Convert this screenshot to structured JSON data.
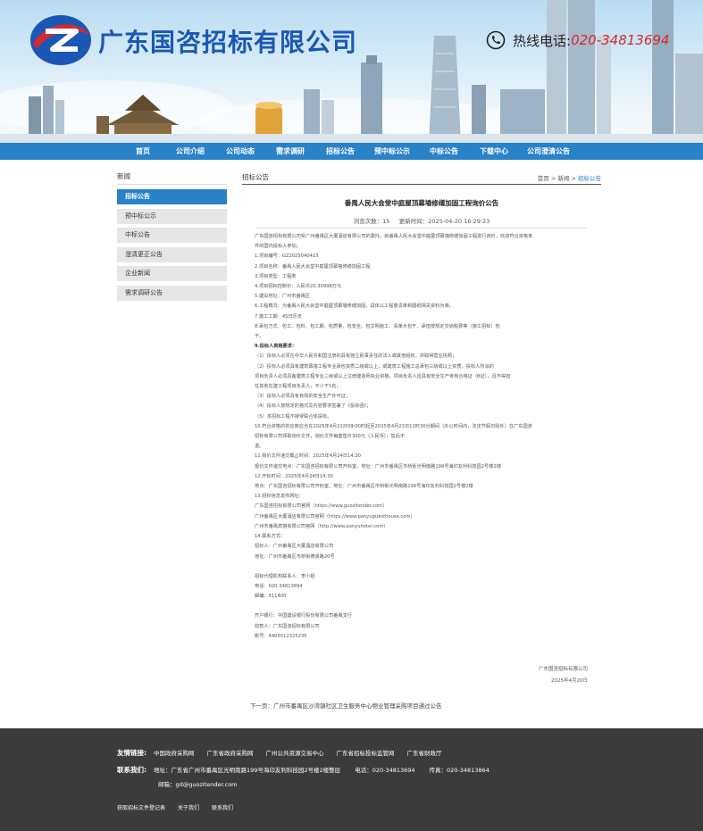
{
  "header": {
    "company_name": "广东国咨招标有限公司",
    "hotline_label": "热线电话:",
    "hotline_number": "020-34813694",
    "brand_color": "#1b57b5",
    "accent_red": "#d9282b"
  },
  "nav": {
    "color": "#2a82c8",
    "items": [
      "首页",
      "公司介绍",
      "公司动态",
      "需求调研",
      "招标公告",
      "预中标公示",
      "中标公告",
      "下载中心",
      "公司澄清公告"
    ]
  },
  "sidebar": {
    "title": "新闻",
    "items": [
      {
        "label": "招标公告",
        "active": true
      },
      {
        "label": "预中标公示"
      },
      {
        "label": "中标公告"
      },
      {
        "label": "澄清更正公告"
      },
      {
        "label": "企业新闻"
      },
      {
        "label": "需求调研公告"
      }
    ]
  },
  "content": {
    "section_title": "招标公告",
    "breadcrumb": [
      "首页",
      ">",
      "新闻",
      ">",
      "招标公告"
    ],
    "article_title": "番禺人民大会堂中庭屋顶幕墙修缮加固工程询价公告",
    "meta": {
      "views_label": "浏览次数：",
      "views": "15",
      "updated_label": "更新时间：",
      "updated": "2025-04-20 16:29:23"
    },
    "lines": [
      {
        "t": "广东国咨招标有限公司受广州番禺区大厦酒店有限公司的委托，就番禺人民大会堂中庭屋顶幕墙修缮加固工程进行询价，欢迎符合资格条"
      },
      {
        "t": "件的国内投标人参加。"
      },
      {
        "t": "1.项目编号：GZ2025040413"
      },
      {
        "t": "2.项目名称：番禺人民大会堂中庭屋顶幕墙修缮加固工程"
      },
      {
        "t": "3.项目类型：工程类"
      },
      {
        "t": "4.项目招标控制价：人民币20.30998万元"
      },
      {
        "t": "5.建设地址：广州市番禺区"
      },
      {
        "t": "6.工程概况：为番禺人民大会堂中庭屋顶幕墙修缮加固，具体以工程量清单和图纸相关资料为准。"
      },
      {
        "t": "7.施工工期：45日历天"
      },
      {
        "t": "8.承包方式：包工、包料、包工期、包质量、包安全、包文明施工、清单大包干、承担按规定交纳税费等（施工招标）包"
      },
      {
        "t": "干。"
      },
      {
        "t": "9.投标人资格要求：",
        "b": true
      },
      {
        "t": "（1）投标人必须在中华人民共和国注册的具有独立民事责任的法人或其他组织，并取得营业执照；"
      },
      {
        "t": "（2）投标人必须具有建筑幕墙工程专业承包资质二级或以上，或建筑工程施工总承包三级或以上资质，投标人所派的"
      },
      {
        "t": "项目负责人必须具备建筑工程专业二级或以上注册建造师执业资格，项目负责人应具有安全生产考核合格证（B证），且不得担"
      },
      {
        "t": "任其他在建工程项目负责人，不少于1名；"
      },
      {
        "t": "（3）投标人必须具有有效的安全生产许可证；"
      },
      {
        "t": "（4）投标人按规定的格式及内容要求签署了《投标函》；"
      },
      {
        "t": "（5）本招标工程不接受联合体投标。"
      },
      {
        "t": "10.符合资格的供应商应当在2025年4月21日09:00时起至2025年4月23日12时30分期间（办公时间内，法定节假日除外）在广东国咨"
      },
      {
        "t": "招标有限公司领取询价文件，询价文件每套售价300元（人民币），售后不"
      },
      {
        "t": "退。"
      },
      {
        "t": "11.报价文件递交截止时间：2025年4月24日14:30"
      },
      {
        "t": "报价文件递交地点：广东国咨招标有限公司开标室，地址：广州市番禺区市桥街光明南路199号海印友利科技园2号楼2楼"
      },
      {
        "t": "12.开标时间：2025年4月24日14:30"
      },
      {
        "t": "地点：广东国咨招标有限公司开标室，地址：广州市番禺区市桥街光明南路199号海印友利科技园2号楼2楼"
      },
      {
        "t": "13.招标信息发布网址："
      },
      {
        "t": "广东国咨招标有限公司官网（https://www.guozitender.com）"
      },
      {
        "t": "广州番禺区大厦酒店有限公司官网（https://www.panyuguesthouse.com）"
      },
      {
        "t": "广州市番禺宾馆有限公司官网（http://www.panyuhotel.com）"
      },
      {
        "t": "14.联系方式："
      },
      {
        "t": "招标人：广州番禺区大厦酒店有限公司"
      },
      {
        "t": "地址：广州市番禺区市桥街德贤路20号"
      },
      {
        "t": "",
        "gap": true
      },
      {
        "t": "招标代理机构联系人：李小姐"
      },
      {
        "t": "电话：020-34813694"
      },
      {
        "t": "邮编：511400"
      },
      {
        "t": "",
        "gap": true
      },
      {
        "t": "开户银行：中国建设银行股份有限公司番禺支行"
      },
      {
        "t": "收款人：广东国咨招标有限公司"
      },
      {
        "t": "账号：4405012325230"
      }
    ],
    "signature_org": "广东国咨招标有限公司",
    "signature_date": "2025年4月20日",
    "next_label": "下一页：",
    "next_title": "广州市番禺区沙湾镇社区卫生服务中心物业管理采购项目通过公告"
  },
  "footer": {
    "links_label": "友情链接:",
    "links": [
      "中国政府采购网",
      "广东省政府采购网",
      "广州公共资源交易中心",
      "广东省招标投标监管网",
      "广东省财政厅"
    ],
    "contact_label": "联系我们:",
    "address": "地址：广东省广州市番禺区光明南路199号海印友利科技园2号楼2楼整层",
    "phone": "电话：020-34813694",
    "fax": "传真：020-34813864",
    "email": "邮箱：gd@guozitender.com",
    "bottom_links": [
      "获取招标文件登记表",
      "关于我们",
      "联系我们"
    ]
  }
}
